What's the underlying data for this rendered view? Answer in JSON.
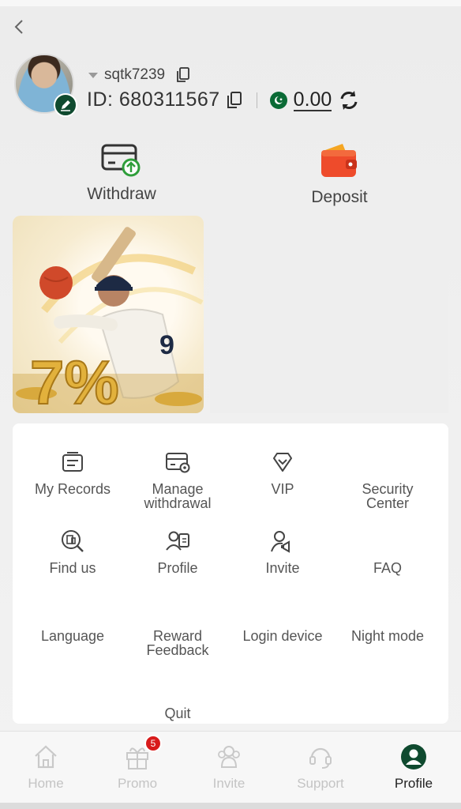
{
  "header": {
    "username": "sqtk7239",
    "id_label": "ID: 680311567",
    "balance": "0.00"
  },
  "quick_actions": {
    "withdraw": "Withdraw",
    "deposit": "Deposit"
  },
  "banner": {
    "promo_text": "7%"
  },
  "menu": {
    "items": [
      {
        "label": "My Records",
        "icon": "records-icon"
      },
      {
        "label": "Manage\nwithdrawal",
        "icon": "wallet-card-icon"
      },
      {
        "label": "VIP",
        "icon": "diamond-icon"
      },
      {
        "label": "Security\nCenter",
        "icon": ""
      },
      {
        "label": "Find us",
        "icon": "search-building-icon"
      },
      {
        "label": "Profile",
        "icon": "profile-card-icon"
      },
      {
        "label": "Invite",
        "icon": "user-megaphone-icon"
      },
      {
        "label": "FAQ",
        "icon": ""
      },
      {
        "label": "Language",
        "icon": ""
      },
      {
        "label": "Reward\nFeedback",
        "icon": ""
      },
      {
        "label": "Login device",
        "icon": ""
      },
      {
        "label": "Night mode",
        "icon": ""
      },
      {
        "label": "Quit",
        "icon": ""
      }
    ]
  },
  "nav": {
    "home": "Home",
    "promo": "Promo",
    "promo_badge": "5",
    "invite": "Invite",
    "support": "Support",
    "profile": "Profile"
  },
  "colors": {
    "brand_green": "#0f4a2f",
    "badge_red": "#d81b1b",
    "inactive_nav": "#c4c4c4"
  }
}
